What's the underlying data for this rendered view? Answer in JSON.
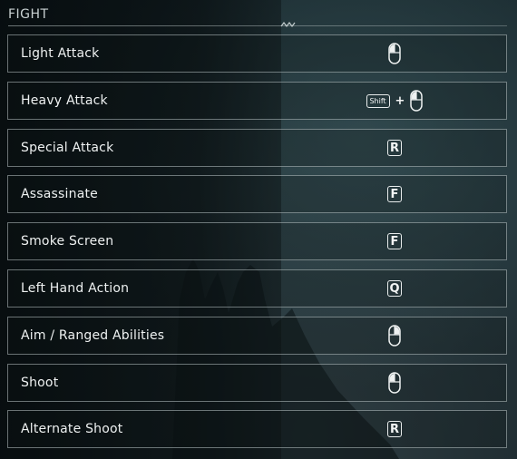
{
  "section": {
    "title": "FIGHT"
  },
  "bindings": [
    {
      "action": "Light Attack",
      "keys": [
        {
          "type": "mouse",
          "icon": "mouse-left-click-icon"
        }
      ]
    },
    {
      "action": "Heavy Attack",
      "keys": [
        {
          "type": "shift",
          "label": "Shift",
          "icon": "shift-key-icon"
        },
        {
          "type": "plus",
          "label": "+"
        },
        {
          "type": "mouse",
          "icon": "mouse-left-click-icon"
        }
      ]
    },
    {
      "action": "Special Attack",
      "keys": [
        {
          "type": "key",
          "label": "R"
        }
      ]
    },
    {
      "action": "Assassinate",
      "keys": [
        {
          "type": "key",
          "label": "F"
        }
      ]
    },
    {
      "action": "Smoke Screen",
      "keys": [
        {
          "type": "key",
          "label": "F"
        }
      ]
    },
    {
      "action": "Left Hand Action",
      "keys": [
        {
          "type": "key",
          "label": "Q"
        }
      ]
    },
    {
      "action": "Aim / Ranged Abilities",
      "keys": [
        {
          "type": "mouse",
          "icon": "mouse-right-click-icon"
        }
      ]
    },
    {
      "action": "Shoot",
      "keys": [
        {
          "type": "mouse",
          "icon": "mouse-left-click-icon"
        }
      ]
    },
    {
      "action": "Alternate Shoot",
      "keys": [
        {
          "type": "key",
          "label": "R"
        }
      ]
    }
  ],
  "colors": {
    "text": "#eef1f1",
    "border": "#b9c4c6",
    "background": "#1d2a2f"
  }
}
